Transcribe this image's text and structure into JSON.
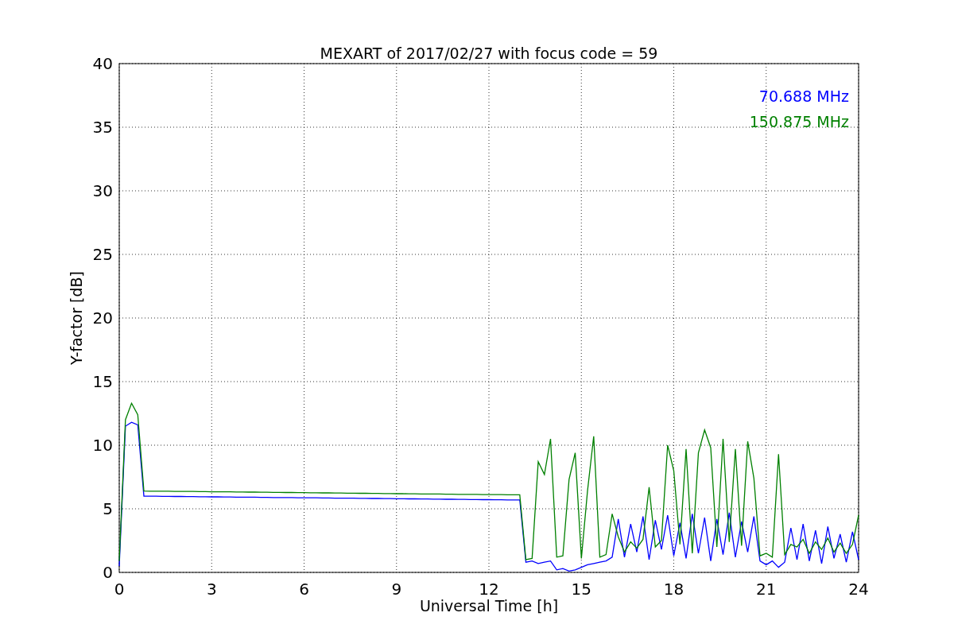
{
  "figure": {
    "chart_data": {
      "type": "line",
      "grid": true,
      "title": "MEXART of 2017/02/27 with focus code = 59",
      "xlabel": "Universal Time [h]",
      "ylabel": "Y-factor [dB]",
      "xlim": [
        0,
        24
      ],
      "ylim": [
        0,
        40
      ],
      "xticks": [
        0,
        3,
        6,
        9,
        12,
        15,
        18,
        21,
        24
      ],
      "yticks": [
        0,
        5,
        10,
        15,
        20,
        25,
        30,
        35,
        40
      ],
      "x": [
        0,
        0.2,
        0.4,
        0.6,
        0.8,
        1,
        1.2,
        1.4,
        1.6,
        1.8,
        2,
        2.2,
        2.4,
        2.6,
        2.8,
        3,
        3.2,
        3.4,
        3.6,
        3.8,
        4,
        4.2,
        4.4,
        4.6,
        4.8,
        5,
        5.2,
        5.4,
        5.6,
        5.8,
        6,
        6.2,
        6.4,
        6.6,
        6.8,
        7,
        7.2,
        7.4,
        7.6,
        7.8,
        8,
        8.2,
        8.4,
        8.6,
        8.8,
        9,
        9.2,
        9.4,
        9.6,
        9.8,
        10,
        10.2,
        10.4,
        10.6,
        10.8,
        11,
        11.2,
        11.4,
        11.6,
        11.8,
        12,
        12.2,
        12.4,
        12.6,
        12.8,
        13,
        13.2,
        13.4,
        13.6,
        13.8,
        14,
        14.2,
        14.4,
        14.6,
        14.8,
        15,
        15.2,
        15.4,
        15.6,
        15.8,
        16,
        16.2,
        16.4,
        16.6,
        16.8,
        17,
        17.2,
        17.4,
        17.6,
        17.8,
        18,
        18.2,
        18.4,
        18.6,
        18.8,
        19,
        19.2,
        19.4,
        19.6,
        19.8,
        20,
        20.2,
        20.4,
        20.6,
        20.8,
        21,
        21.2,
        21.4,
        21.6,
        21.8,
        22,
        22.2,
        22.4,
        22.6,
        22.8,
        23,
        23.2,
        23.4,
        23.6,
        23.8,
        24
      ],
      "series": [
        {
          "name": "70.688 MHz",
          "color": "#0000ff",
          "values": [
            0.5,
            11.5,
            11.8,
            11.6,
            6.0,
            5.99,
            5.99,
            5.98,
            5.98,
            5.97,
            5.97,
            5.96,
            5.96,
            5.95,
            5.95,
            5.94,
            5.94,
            5.93,
            5.93,
            5.92,
            5.92,
            5.91,
            5.91,
            5.9,
            5.9,
            5.89,
            5.89,
            5.88,
            5.88,
            5.87,
            5.87,
            5.86,
            5.86,
            5.85,
            5.85,
            5.84,
            5.84,
            5.83,
            5.83,
            5.82,
            5.82,
            5.81,
            5.81,
            5.8,
            5.8,
            5.79,
            5.79,
            5.78,
            5.78,
            5.77,
            5.77,
            5.76,
            5.76,
            5.75,
            5.75,
            5.74,
            5.74,
            5.73,
            5.73,
            5.72,
            5.72,
            5.71,
            5.71,
            5.7,
            5.7,
            5.7,
            0.8,
            0.9,
            0.7,
            0.8,
            0.9,
            0.2,
            0.3,
            0.1,
            0.2,
            0.4,
            0.6,
            0.7,
            0.8,
            0.9,
            1.2,
            4.2,
            1.2,
            3.8,
            1.6,
            4.4,
            1.0,
            4.1,
            1.8,
            4.5,
            1.3,
            3.9,
            1.1,
            4.6,
            1.5,
            4.3,
            0.9,
            4.2,
            1.4,
            4.7,
            1.2,
            4.0,
            1.6,
            4.4,
            0.9,
            0.6,
            0.9,
            0.4,
            0.8,
            3.5,
            1.0,
            3.8,
            0.9,
            3.3,
            0.7,
            3.6,
            1.1,
            3.0,
            0.8,
            3.2,
            1.0
          ]
        },
        {
          "name": "150.875 MHz",
          "color": "#008000",
          "values": [
            0.9,
            12.0,
            13.3,
            12.4,
            6.4,
            6.39,
            6.39,
            6.38,
            6.38,
            6.37,
            6.37,
            6.36,
            6.36,
            6.35,
            6.35,
            6.34,
            6.34,
            6.33,
            6.33,
            6.32,
            6.32,
            6.31,
            6.31,
            6.3,
            6.3,
            6.29,
            6.29,
            6.28,
            6.28,
            6.27,
            6.27,
            6.26,
            6.26,
            6.25,
            6.25,
            6.24,
            6.24,
            6.23,
            6.23,
            6.22,
            6.22,
            6.21,
            6.21,
            6.2,
            6.2,
            6.19,
            6.19,
            6.18,
            6.18,
            6.17,
            6.17,
            6.16,
            6.16,
            6.15,
            6.15,
            6.14,
            6.14,
            6.13,
            6.13,
            6.12,
            6.12,
            6.11,
            6.11,
            6.1,
            6.1,
            6.1,
            1.0,
            1.1,
            8.7,
            7.7,
            10.5,
            1.2,
            1.3,
            7.3,
            9.4,
            1.1,
            6.4,
            10.7,
            1.2,
            1.4,
            4.6,
            2.8,
            1.6,
            2.4,
            1.9,
            2.6,
            6.7,
            2.0,
            2.5,
            10.0,
            8.0,
            2.2,
            9.7,
            1.5,
            9.4,
            11.2,
            9.8,
            2.0,
            10.5,
            2.4,
            9.7,
            2.1,
            10.3,
            7.4,
            1.3,
            1.5,
            1.2,
            9.3,
            1.4,
            2.2,
            2.0,
            2.6,
            1.5,
            2.4,
            1.8,
            2.7,
            1.6,
            2.3,
            1.5,
            2.2,
            4.5
          ]
        }
      ]
    }
  }
}
